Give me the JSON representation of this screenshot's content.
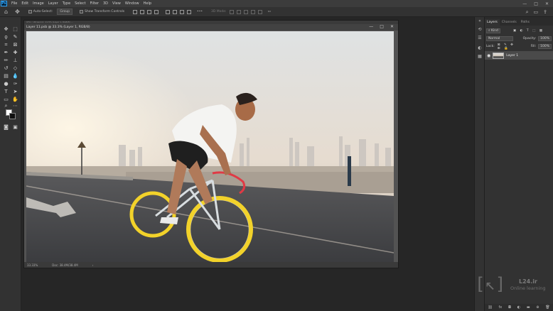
{
  "menu": {
    "logo": "Ps",
    "items": [
      "File",
      "Edit",
      "Image",
      "Layer",
      "Type",
      "Select",
      "Filter",
      "3D",
      "View",
      "Window",
      "Help"
    ]
  },
  "window_controls": [
    "—",
    "□",
    "✕"
  ],
  "options": {
    "auto_select_label": "Auto-Select:",
    "auto_select_value": "Group",
    "show_transform_label": "Show Transform Controls",
    "mode_3d_label": "3D Mode:"
  },
  "document": {
    "outer_title": "UFLI · Ultrasonic: 11.5% (Layer 1, RGB/8) ...",
    "title": "Layer 11.psb @ 33.3% (Layer 1, RGB/8)",
    "zoom": "33.33%",
    "doc_size": "Doc: 38.4M/38.4M"
  },
  "layers_panel": {
    "tabs": [
      "Layers",
      "Channels",
      "Paths"
    ],
    "kind_label": "Kind",
    "blend_mode": "Normal",
    "opacity_label": "Opacity:",
    "opacity_value": "100%",
    "lock_label": "Lock:",
    "fill_label": "Fill:",
    "fill_value": "100%",
    "layer_name": "Layer 1",
    "bottom_icons": [
      "link-icon",
      "fx-icon",
      "mask-icon",
      "adjustment-icon",
      "group-icon",
      "new-layer-icon",
      "trash-icon"
    ]
  },
  "watermark": {
    "title": "L24.ir",
    "subtitle": "Online learning"
  },
  "colors": {
    "app_bg": "#262626",
    "panel_bg": "#323232",
    "accent": "#31a8ff"
  }
}
